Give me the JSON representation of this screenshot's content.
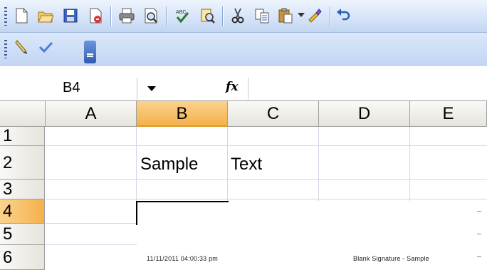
{
  "toolbar_standard": {
    "buttons": [
      {
        "name": "new-icon",
        "label": "New"
      },
      {
        "name": "open-icon",
        "label": "Open"
      },
      {
        "name": "save-icon",
        "label": "Save"
      },
      {
        "name": "permission-icon",
        "label": "Permission"
      },
      {
        "name": "print-icon",
        "label": "Print"
      },
      {
        "name": "print-preview-icon",
        "label": "Print Preview"
      },
      {
        "name": "spelling-icon",
        "label": "Spelling"
      },
      {
        "name": "research-icon",
        "label": "Research"
      },
      {
        "name": "cut-icon",
        "label": "Cut"
      },
      {
        "name": "copy-icon",
        "label": "Copy"
      },
      {
        "name": "paste-icon",
        "label": "Paste"
      },
      {
        "name": "format-painter-icon",
        "label": "Format Painter"
      },
      {
        "name": "undo-icon",
        "label": "Undo"
      }
    ],
    "spelling_badge": "ABC"
  },
  "toolbar_signature": {
    "buttons": [
      {
        "name": "signature-pen-icon",
        "label": "Sign"
      },
      {
        "name": "checkmark-icon",
        "label": "Verify"
      }
    ]
  },
  "formula_bar": {
    "name_box": "B4",
    "fx_label": "fx",
    "formula": ""
  },
  "grid": {
    "columns": [
      "A",
      "B",
      "C",
      "D",
      "E"
    ],
    "rows": [
      "1",
      "2",
      "3",
      "4",
      "5",
      "6"
    ],
    "selected_column": "B",
    "selected_row": "4",
    "cells": {
      "B2": "Sample",
      "C2": "Text"
    }
  },
  "signature_object": {
    "timestamp": "11/11/2011 04:00:33 pm",
    "caption": "Blank Signature - Sample"
  },
  "colors": {
    "toolbar_blue": "#c3d6f3",
    "selected_header": "#f5b14a",
    "gridline": "#d0d7e5"
  }
}
